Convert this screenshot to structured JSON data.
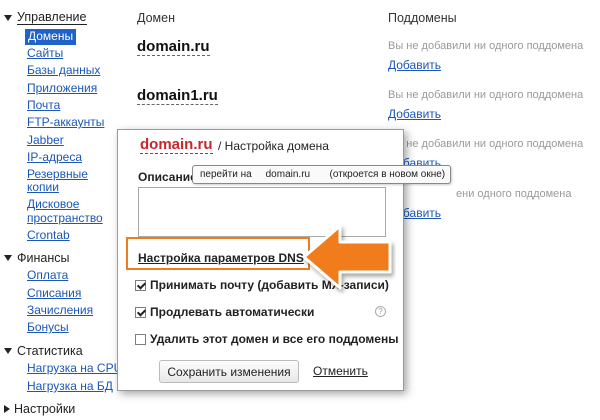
{
  "sidebar": {
    "management": {
      "label": "Управление",
      "items": [
        "Домены",
        "Сайты",
        "Базы данных",
        "Приложения",
        "Почта",
        "FTP-аккаунты",
        "Jabber",
        "IP-адреса",
        "Резервные",
        "копии",
        "Дисковое",
        "пространство",
        "Crontab"
      ]
    },
    "finance": {
      "label": "Финансы",
      "items": [
        "Оплата",
        "Списания",
        "Зачисления",
        "Бонусы"
      ]
    },
    "stats": {
      "label": "Статистика",
      "items": [
        "Нагрузка на CPU",
        "Нагрузка на БД"
      ]
    },
    "settings": {
      "label": "Настройки"
    }
  },
  "table": {
    "col_domain": "Домен",
    "col_subdomains": "Поддомены",
    "rows": [
      {
        "domain": "domain.ru",
        "no_sub": "Вы не добавили ни одного поддомена",
        "add": "Добавить"
      },
      {
        "domain": "domain1.ru",
        "no_sub": "Вы не добавили ни одного поддомена",
        "add": "Добавить"
      }
    ],
    "partial_rows": [
      {
        "no_sub": "Вы не добавили ни одного поддомена",
        "add": "Добавить"
      },
      {
        "no_sub": "ени одного поддомена",
        "add": "Добавить"
      }
    ]
  },
  "panel": {
    "domain": "domain.ru",
    "title": "/ Настройка домена",
    "description_label": "Описание",
    "dns_link": "Настройка параметров DNS",
    "opt_mail": "Принимать почту (добавить MX-записи)",
    "opt_renew": "Продлевать автоматически",
    "opt_delete": "Удалить этот домен и все его поддомены",
    "help": "?",
    "save": "Сохранить изменения",
    "cancel": "Отменить"
  },
  "tooltip": {
    "part1": "перейти на",
    "part2": "domain.ru",
    "part3": "(откроется в новом окне)"
  },
  "colors": {
    "link": "#1a57b8",
    "active_bg": "#1f62c9",
    "panel_domain": "#c9262c",
    "highlight": "#f07c1e"
  }
}
